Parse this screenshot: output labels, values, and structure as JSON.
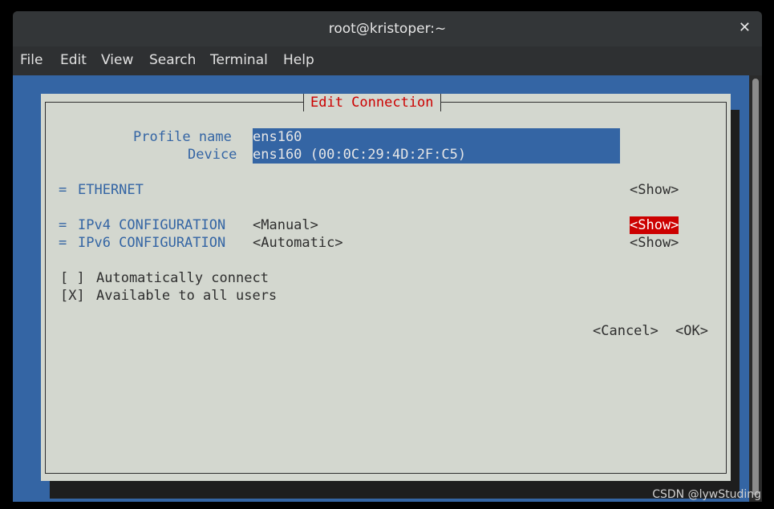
{
  "window": {
    "title": "root@kristoper:~",
    "close_glyph": "✕"
  },
  "menu": {
    "items": [
      "File",
      "Edit",
      "View",
      "Search",
      "Terminal",
      "Help"
    ]
  },
  "dialog": {
    "title": "Edit Connection",
    "profile_label": "Profile name",
    "profile_value": "ens160",
    "device_label": "Device",
    "device_value": "ens160 (00:0C:29:4D:2F:C5)",
    "ethernet": {
      "marker": "=",
      "label": "ETHERNET",
      "show": "<Show>"
    },
    "ipv4": {
      "marker": "=",
      "label": "IPv4 CONFIGURATION",
      "mode": "<Manual>",
      "show": "<Show>"
    },
    "ipv6": {
      "marker": "=",
      "label": "IPv6 CONFIGURATION",
      "mode": "<Automatic>",
      "show": "<Show>"
    },
    "auto_connect": {
      "box": "[ ]",
      "label": "Automatically connect",
      "checked": false
    },
    "all_users": {
      "box": "[X]",
      "label": "Available to all users",
      "checked": true
    },
    "cancel": "<Cancel>",
    "ok": "<OK>"
  },
  "watermark": "CSDN @lywStuding",
  "colors": {
    "terminal_bg": "#3465a4",
    "dialog_bg": "#d3d7cf",
    "label_blue": "#3465a4",
    "accent_red": "#cc0000"
  }
}
